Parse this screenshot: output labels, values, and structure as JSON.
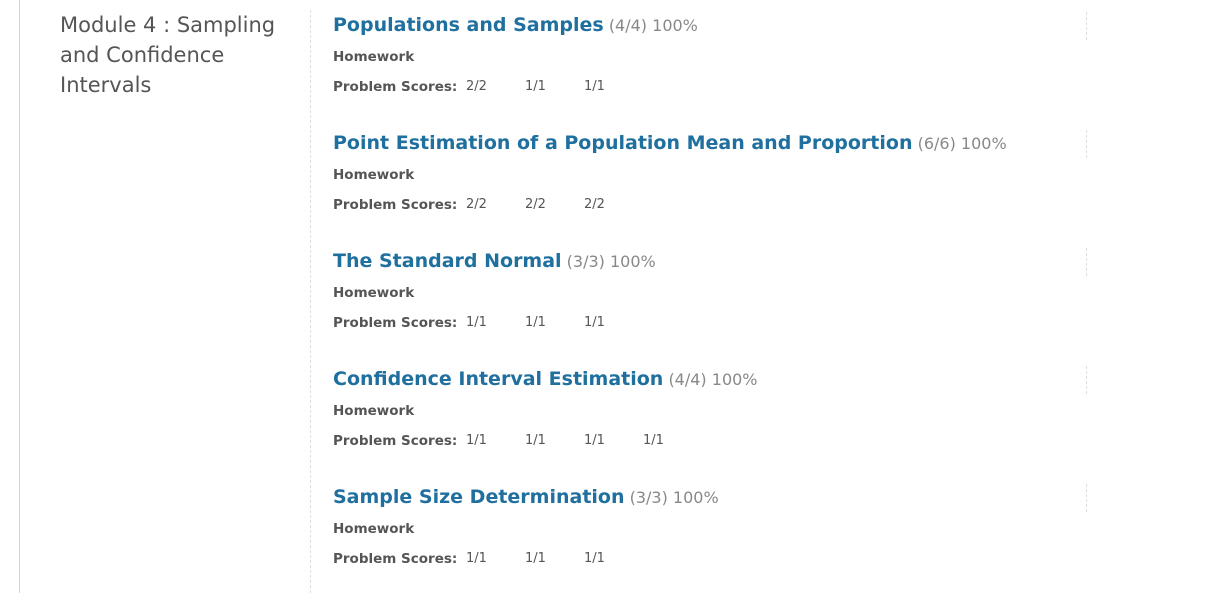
{
  "module": {
    "title": "Module 4 : Sampling and Confidence Intervals"
  },
  "sections": [
    {
      "title": "Populations and Samples",
      "score": "(4/4) 100%",
      "type": "Homework",
      "scores_label": "Problem Scores:",
      "problem_scores": [
        "2/2",
        "1/1",
        "1/1"
      ]
    },
    {
      "title": "Point Estimation of a Population Mean and Proportion",
      "score": "(6/6) 100%",
      "type": "Homework",
      "scores_label": "Problem Scores:",
      "problem_scores": [
        "2/2",
        "2/2",
        "2/2"
      ]
    },
    {
      "title": "The Standard Normal",
      "score": "(3/3) 100%",
      "type": "Homework",
      "scores_label": "Problem Scores:",
      "problem_scores": [
        "1/1",
        "1/1",
        "1/1"
      ]
    },
    {
      "title": "Confidence Interval Estimation",
      "score": "(4/4) 100%",
      "type": "Homework",
      "scores_label": "Problem Scores:",
      "problem_scores": [
        "1/1",
        "1/1",
        "1/1",
        "1/1"
      ]
    },
    {
      "title": "Sample Size Determination",
      "score": "(3/3) 100%",
      "type": "Homework",
      "scores_label": "Problem Scores:",
      "problem_scores": [
        "1/1",
        "1/1",
        "1/1"
      ]
    }
  ],
  "colors": {
    "link": "#1f6f9f",
    "muted": "#888888",
    "text": "#555555"
  }
}
